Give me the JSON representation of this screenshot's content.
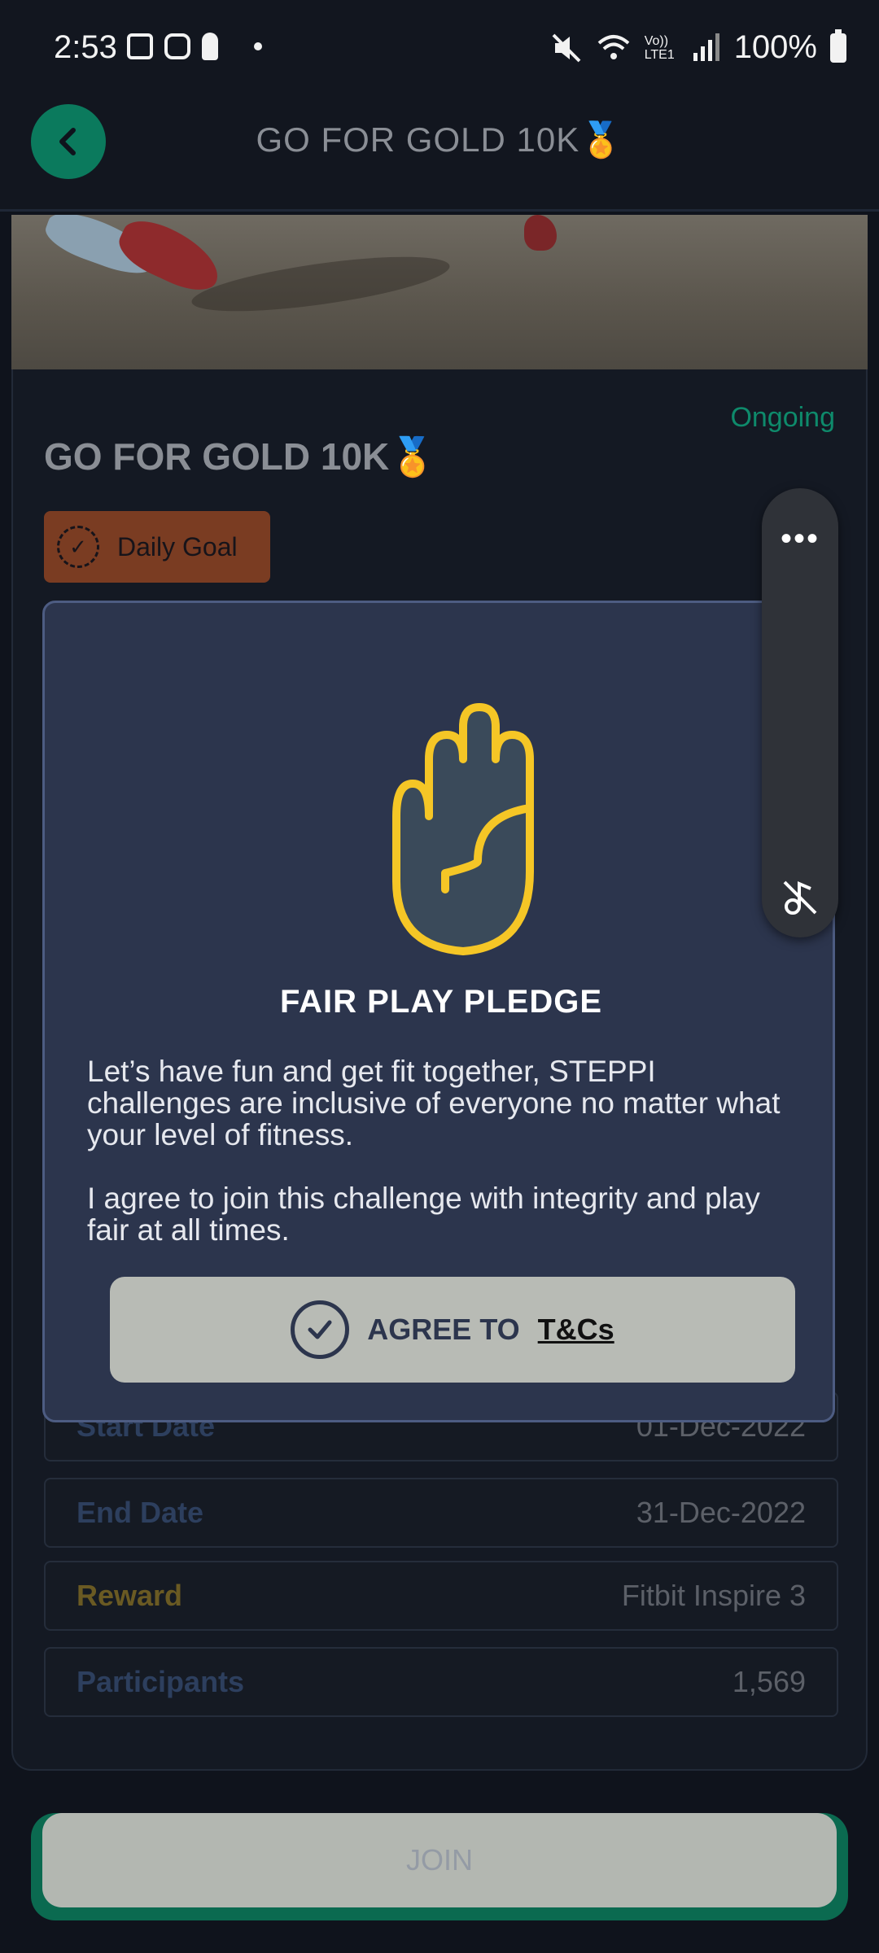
{
  "status_bar": {
    "time": "2:53",
    "battery": "100%",
    "network": "Vo)) LTE1",
    "icons": [
      "gallery-icon",
      "instagram-icon",
      "keyhole-icon",
      "dot-icon",
      "mute-icon",
      "wifi-icon",
      "signal-icon",
      "battery-icon"
    ]
  },
  "header": {
    "title": "GO FOR GOLD 10K🏅",
    "back_icon": "chevron-left-icon"
  },
  "challenge": {
    "status": "Ongoing",
    "title": "GO FOR GOLD 10K🏅",
    "goal_badge": "Daily Goal",
    "rows": [
      {
        "label": "Start Date",
        "value": "01-Dec-2022"
      },
      {
        "label": "End Date",
        "value": "31-Dec-2022"
      },
      {
        "label": "Reward",
        "value": "Fitbit Inspire 3"
      },
      {
        "label": "Participants",
        "value": "1,569"
      }
    ]
  },
  "join_button": "JOIN",
  "modal": {
    "title": "FAIR PLAY PLEDGE",
    "paragraph1": "Let’s have fun and get fit together, STEPPI challenges are inclusive of everyone no matter what your level of fitness.",
    "paragraph2": "I agree to join this challenge with integrity and play fair at all times.",
    "agree_prefix": "AGREE TO",
    "agree_link": "T&Cs"
  },
  "floating_panel": {
    "more_label": "•••"
  },
  "colors": {
    "accent": "#0b7a5d",
    "modal_bg": "#2c354d",
    "hand_outline": "#f5c626",
    "hand_fill": "#3a4a5a"
  }
}
